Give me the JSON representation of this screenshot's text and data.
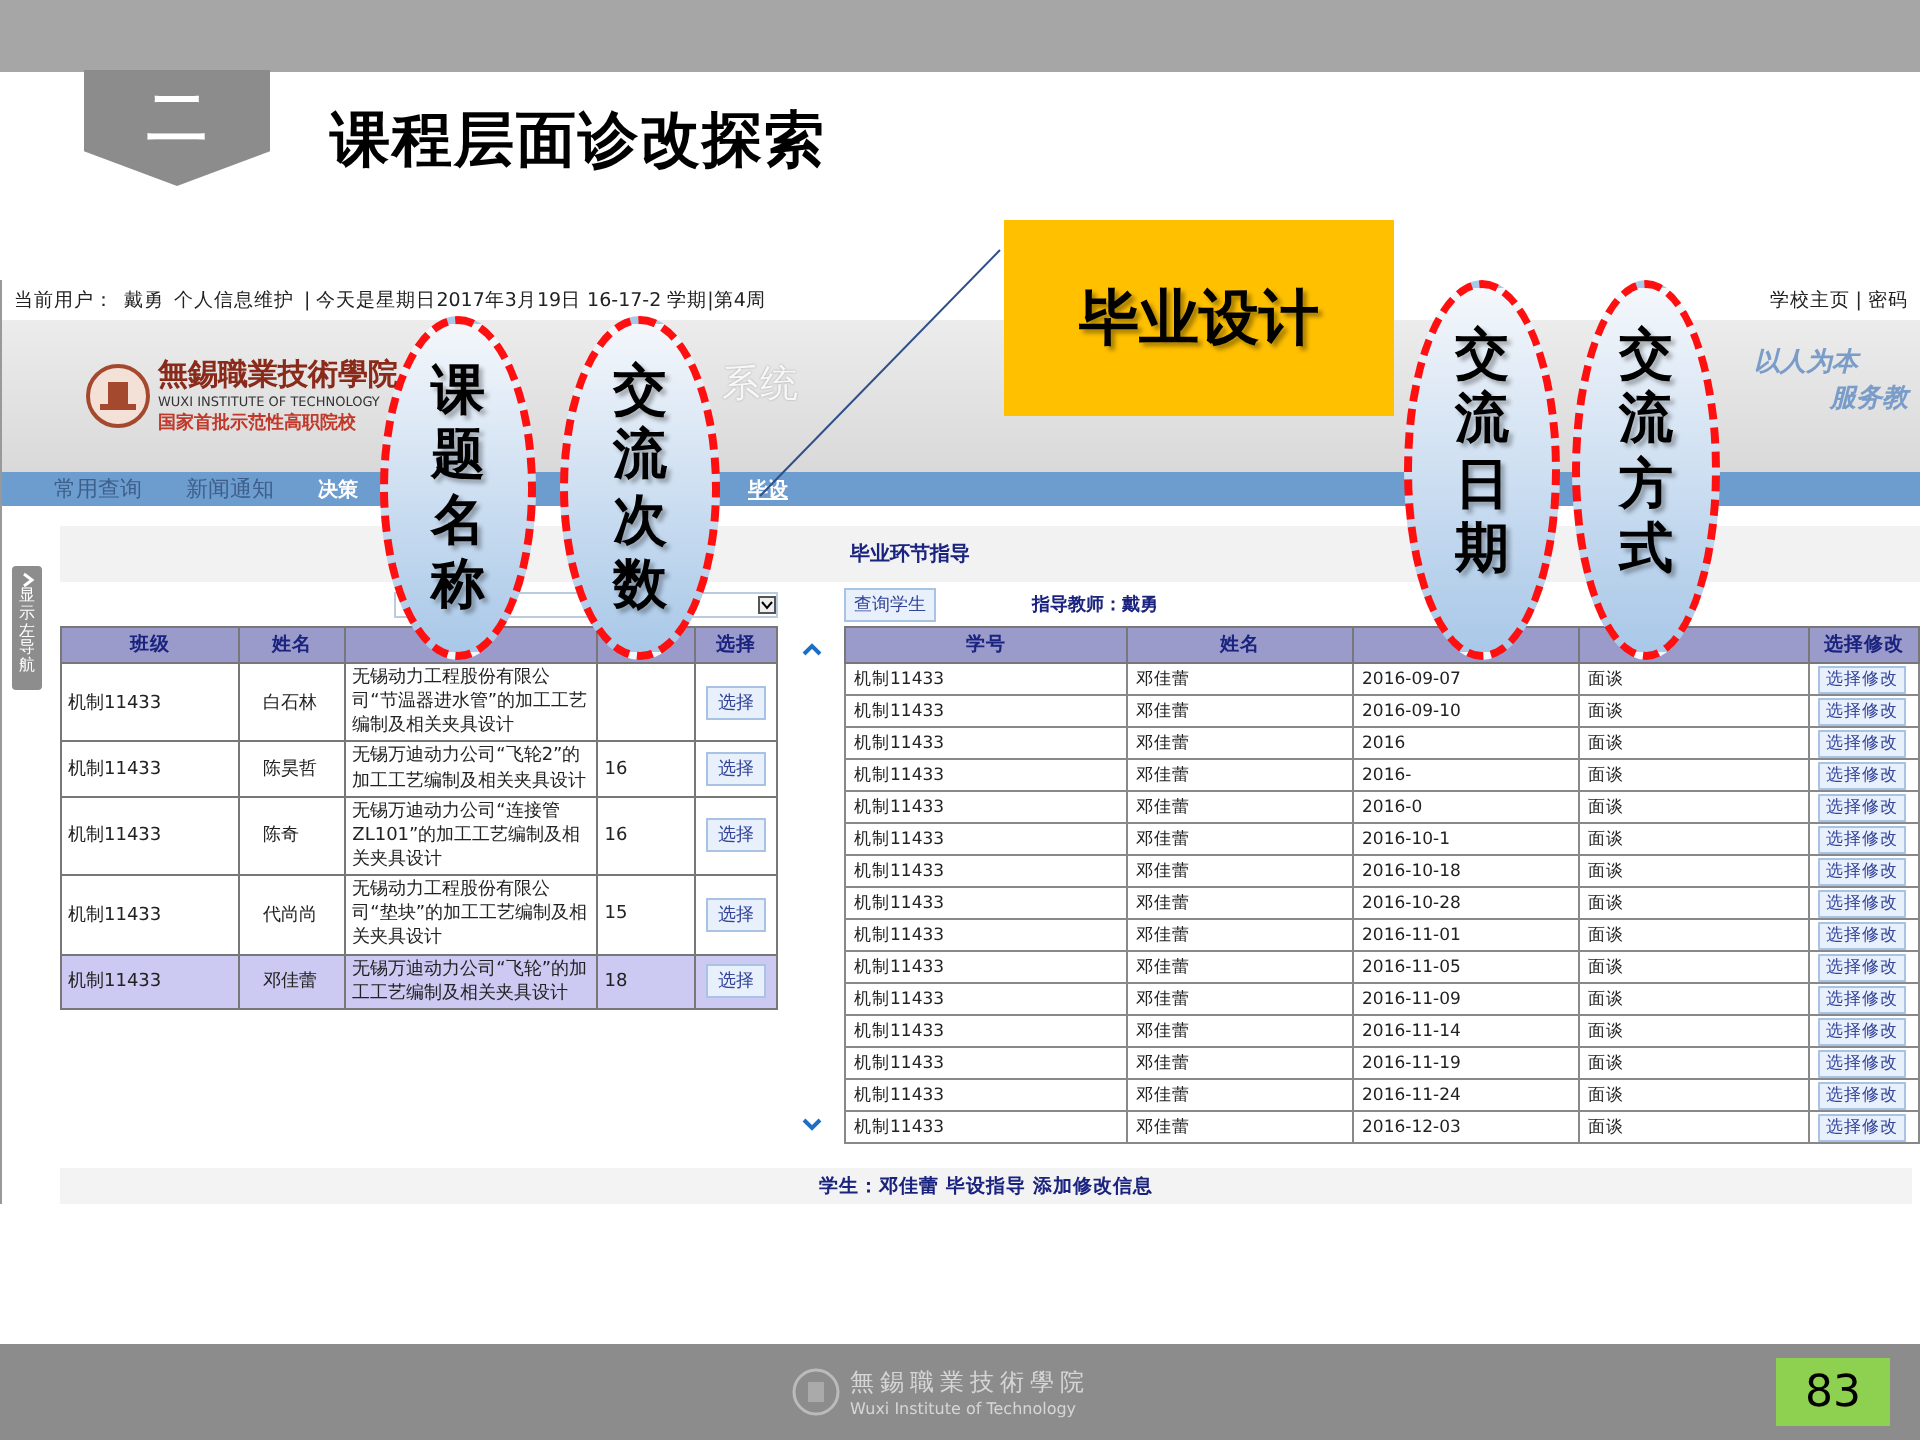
{
  "slide": {
    "section_number": "二",
    "title": "课程层面诊改探索",
    "page_number": "83"
  },
  "callout": {
    "label": "毕业设计"
  },
  "annotations": [
    {
      "label": "课题名称"
    },
    {
      "label": "交流次数"
    },
    {
      "label": "交流日期"
    },
    {
      "label": "交流方式"
    }
  ],
  "status_bar": {
    "user_label": "当前用户：",
    "user": "戴勇",
    "profile_link": "个人信息维护",
    "date_text": "| 今天是星期日2017年3月19日 16-17-2 学期|第4周",
    "links": [
      "学校主页 | 密码"
    ]
  },
  "banner": {
    "school_name": "無錫職業技術學院",
    "school_name_en": "WUXI INSTITUTE OF TECHNOLOGY",
    "school_tagline": "国家首批示范性高职院校",
    "system_title": "系统",
    "motto": [
      "以人为本",
      "服务教"
    ]
  },
  "nav": [
    {
      "label": "常用查询",
      "selected": false
    },
    {
      "label": "新闻通知",
      "selected": false
    },
    {
      "label": "决策",
      "selected": false
    },
    {
      "label": "毕设",
      "selected": true
    }
  ],
  "side_tab": {
    "label": "显示左导航"
  },
  "page_heading": "毕业环节指导",
  "left_panel": {
    "columns": [
      "班级",
      "姓名",
      "选择"
    ],
    "rows": [
      {
        "class": "机制11433",
        "name": "白石林",
        "topic": "无锡动力工程股份有限公司“节温器进水管”的加工工艺编制及相关夹具设计",
        "button": "选择",
        "selected": false
      },
      {
        "class": "机制11433",
        "name": "陈昊哲",
        "topic": "无锡万迪动力公司“飞轮2”的加工工艺编制及相关夹具设计",
        "count": "16",
        "button": "选择",
        "selected": false
      },
      {
        "class": "机制11433",
        "name": "陈奇",
        "topic": "无锡万迪动力公司“连接管ZL101”的加工工艺编制及相关夹具设计",
        "count": "16",
        "button": "选择",
        "selected": false
      },
      {
        "class": "机制11433",
        "name": "代尚尚",
        "topic": "无锡动力工程股份有限公司“垫块”的加工工艺编制及相关夹具设计",
        "count": "15",
        "button": "选择",
        "selected": false
      },
      {
        "class": "机制11433",
        "name": "邓佳蕾",
        "topic": "无锡万迪动力公司“飞轮”的加工工艺编制及相关夹具设计",
        "count": "18",
        "button": "选择",
        "selected": true
      }
    ]
  },
  "right_panel": {
    "query_button": "查询学生",
    "teacher": "指导教师：戴勇",
    "columns": [
      "学号",
      "姓名",
      "选择修改"
    ],
    "rows": [
      {
        "id": "机制11433",
        "name": "邓佳蕾",
        "date": "2016-09-07",
        "method": "面谈",
        "button": "选择修改"
      },
      {
        "id": "机制11433",
        "name": "邓佳蕾",
        "date": "2016-09-10",
        "method": "面谈",
        "button": "选择修改"
      },
      {
        "id": "机制11433",
        "name": "邓佳蕾",
        "date": "2016",
        "method": "面谈",
        "button": "选择修改"
      },
      {
        "id": "机制11433",
        "name": "邓佳蕾",
        "date": "2016-",
        "method": "面谈",
        "button": "选择修改"
      },
      {
        "id": "机制11433",
        "name": "邓佳蕾",
        "date": "2016-0",
        "method": "面谈",
        "button": "选择修改"
      },
      {
        "id": "机制11433",
        "name": "邓佳蕾",
        "date": "2016-10-1",
        "method": "面谈",
        "button": "选择修改"
      },
      {
        "id": "机制11433",
        "name": "邓佳蕾",
        "date": "2016-10-18",
        "method": "面谈",
        "button": "选择修改"
      },
      {
        "id": "机制11433",
        "name": "邓佳蕾",
        "date": "2016-10-28",
        "method": "面谈",
        "button": "选择修改"
      },
      {
        "id": "机制11433",
        "name": "邓佳蕾",
        "date": "2016-11-01",
        "method": "面谈",
        "button": "选择修改"
      },
      {
        "id": "机制11433",
        "name": "邓佳蕾",
        "date": "2016-11-05",
        "method": "面谈",
        "button": "选择修改"
      },
      {
        "id": "机制11433",
        "name": "邓佳蕾",
        "date": "2016-11-09",
        "method": "面谈",
        "button": "选择修改"
      },
      {
        "id": "机制11433",
        "name": "邓佳蕾",
        "date": "2016-11-14",
        "method": "面谈",
        "button": "选择修改"
      },
      {
        "id": "机制11433",
        "name": "邓佳蕾",
        "date": "2016-11-19",
        "method": "面谈",
        "button": "选择修改"
      },
      {
        "id": "机制11433",
        "name": "邓佳蕾",
        "date": "2016-11-24",
        "method": "面谈",
        "button": "选择修改"
      },
      {
        "id": "机制11433",
        "name": "邓佳蕾",
        "date": "2016-12-03",
        "method": "面谈",
        "button": "选择修改"
      }
    ]
  },
  "footer_text": "学生：邓佳蕾 毕设指导 添加修改信息",
  "bottom_bar": {
    "school_name": "無錫職業技術學院",
    "school_name_en": "Wuxi Institute of Technology"
  }
}
